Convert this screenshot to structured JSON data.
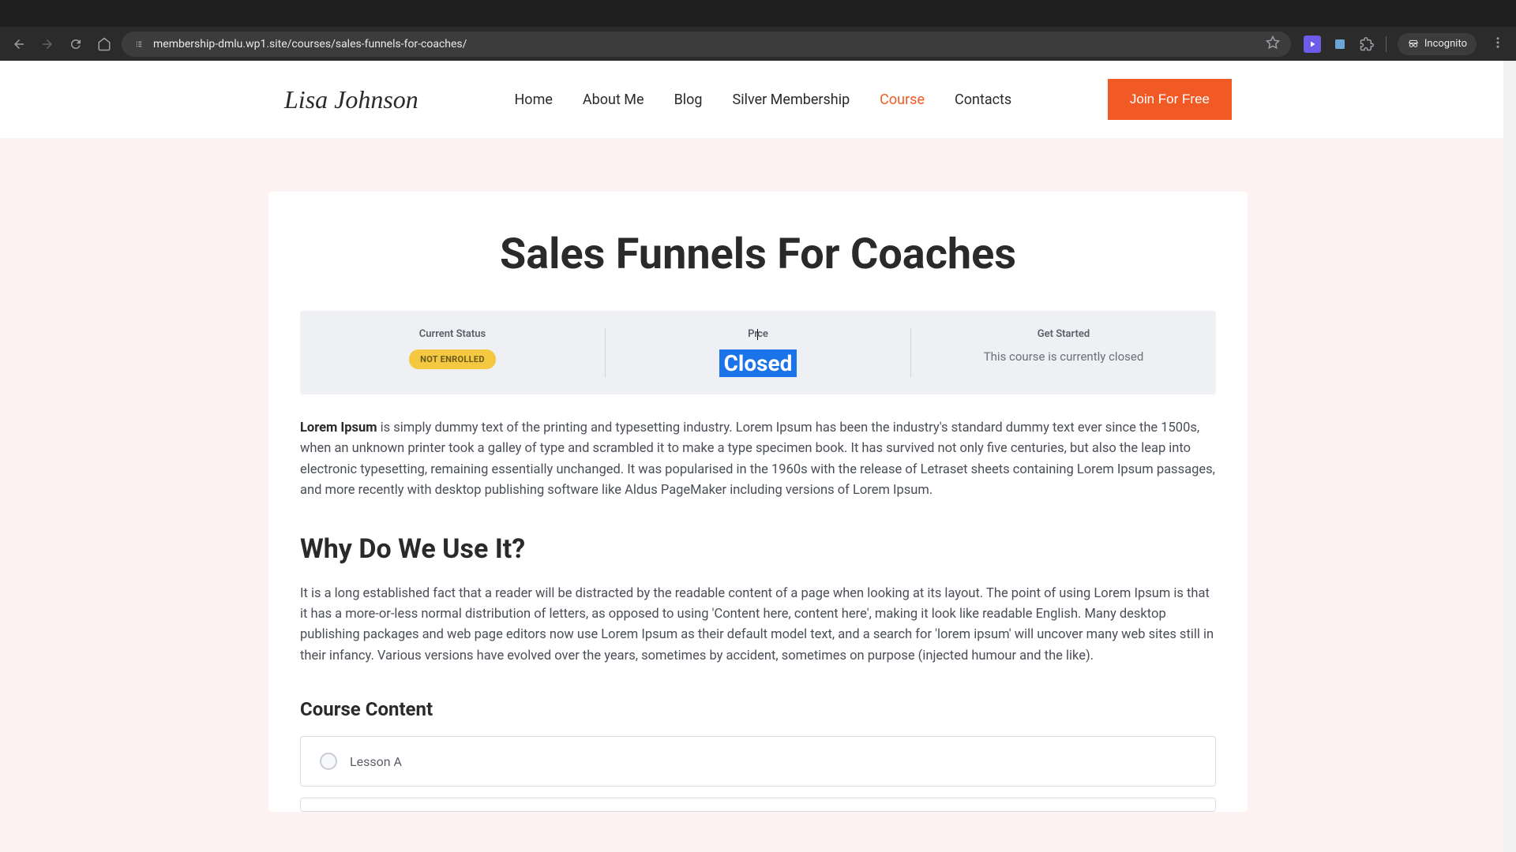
{
  "browser": {
    "url": "membership-dmlu.wp1.site/courses/sales-funnels-for-coaches/",
    "incognito": "Incognito"
  },
  "header": {
    "logo": "Lisa Johnson",
    "nav": [
      "Home",
      "About Me",
      "Blog",
      "Silver Membership",
      "Course",
      "Contacts"
    ],
    "active_index": 4,
    "cta": "Join For Free"
  },
  "page": {
    "title": "Sales Funnels For Coaches"
  },
  "status": {
    "current_label": "Current Status",
    "current_value": "NOT ENROLLED",
    "price_label": "Price",
    "price_value": "Closed",
    "start_label": "Get Started",
    "start_value": "This course is currently closed"
  },
  "intro": {
    "bold": "Lorem Ipsum",
    "rest": " is simply dummy text of the printing and typesetting industry. Lorem Ipsum has been the industry's standard dummy text ever since the 1500s, when an unknown printer took a galley of type and scrambled it to make a type specimen book. It has survived not only five centuries, but also the leap into electronic typesetting, remaining essentially unchanged. It was popularised in the 1960s with the release of Letraset sheets containing Lorem Ipsum passages, and more recently with desktop publishing software like Aldus PageMaker including versions of Lorem Ipsum."
  },
  "why": {
    "heading": "Why Do We Use It?",
    "body": "It is a long established fact that a reader will be distracted by the readable content of a page when looking at its layout. The point of using Lorem Ipsum is that it has a more-or-less normal distribution of letters, as opposed to using 'Content here, content here', making it look like readable English. Many desktop publishing packages and web page editors now use Lorem Ipsum as their default model text, and a search for 'lorem ipsum' will uncover many web sites still in their infancy. Various versions have evolved over the years, sometimes by accident, sometimes on purpose (injected humour and the like)."
  },
  "course_content": {
    "heading": "Course Content",
    "lessons": [
      "Lesson A"
    ]
  }
}
